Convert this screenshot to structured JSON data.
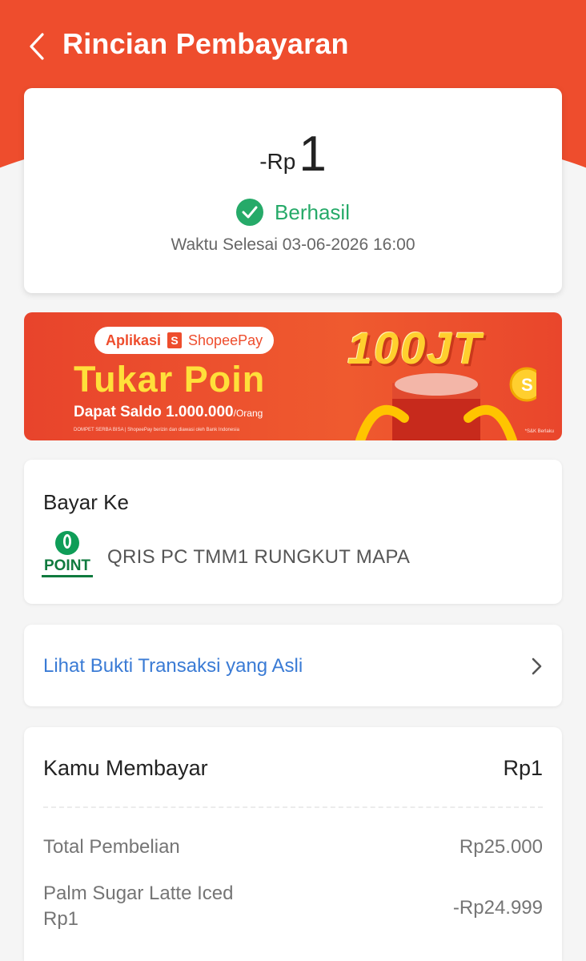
{
  "header": {
    "title": "Rincian Pembayaran"
  },
  "summary": {
    "currency_prefix": "-Rp",
    "amount": "1",
    "status": "Berhasil",
    "completed_time": "Waktu Selesai 03-06-2026 16:00"
  },
  "banner": {
    "badge_app": "Aplikasi",
    "badge_brand": "ShopeePay",
    "badge_brand_icon": "S",
    "headline": "Tukar Poin",
    "subline": "Dapat Saldo 1.000.000",
    "subline_unit": "/Orang",
    "prize": "100JT",
    "fine_print": "DOMPET SERBA BISA | ShopeePay berizin dan diawasi oleh Bank Indonesia",
    "tnc": "*S&K Berlaku"
  },
  "pay_to": {
    "label": "Bayar Ke",
    "logo_text": "POINT",
    "merchant": "QRIS PC TMM1 RUNGKUT MAPA"
  },
  "proof": {
    "link": "Lihat Bukti Transaksi yang Asli"
  },
  "payment": {
    "you_pay_label": "Kamu Membayar",
    "you_pay_value": "Rp1",
    "total_label": "Total Pembelian",
    "total_value": "Rp25.000",
    "item_label_line1": "Palm Sugar Latte Iced",
    "item_label_line2": "Rp1",
    "item_value": "-Rp24.999"
  },
  "colors": {
    "brand": "#ee4d2d",
    "success": "#26aa69",
    "link": "#3a7bd5"
  }
}
